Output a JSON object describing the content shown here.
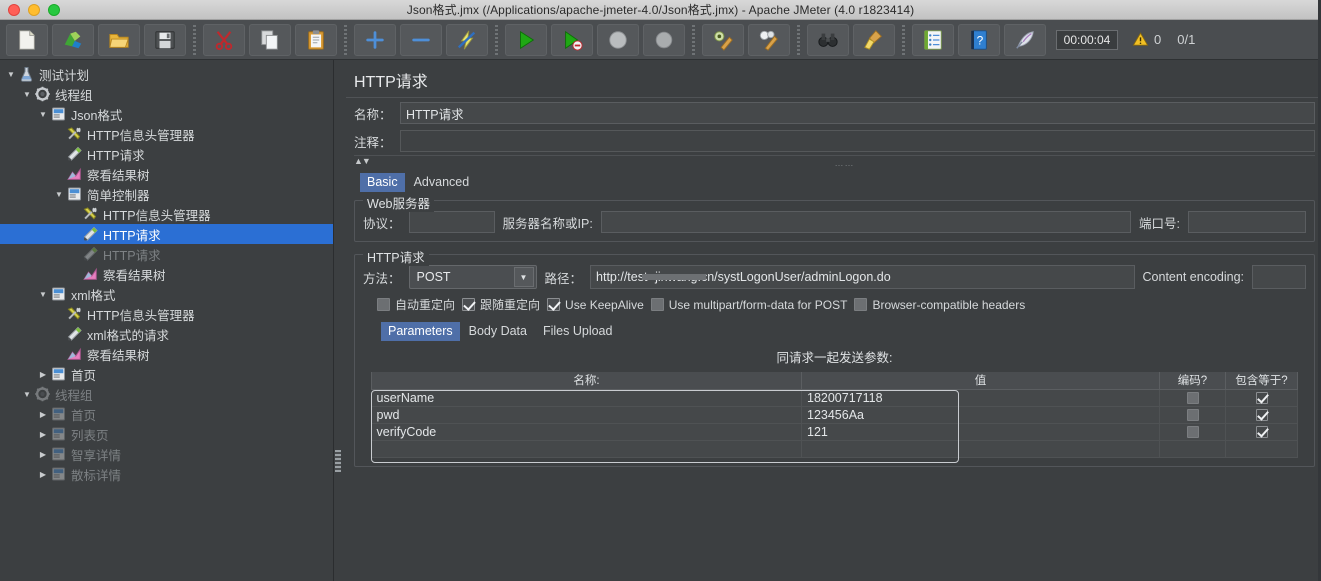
{
  "window": {
    "title": "Json格式.jmx (/Applications/apache-jmeter-4.0/Json格式.jmx) - Apache JMeter (4.0 r1823414)"
  },
  "toolbar": {
    "buttons": [
      {
        "name": "new-test-plan-button",
        "icon": "new-document-icon",
        "label": "New"
      },
      {
        "name": "templates-button",
        "icon": "templates-icon",
        "label": "Templates"
      },
      {
        "name": "open-button",
        "icon": "open-folder-icon",
        "label": "Open"
      },
      {
        "name": "save-button",
        "icon": "save-floppy-icon",
        "label": "Save"
      },
      {
        "name": "cut-button",
        "icon": "scissors-icon",
        "label": "Cut"
      },
      {
        "name": "copy-button",
        "icon": "copy-icon",
        "label": "Copy"
      },
      {
        "name": "paste-button",
        "icon": "clipboard-paste-icon",
        "label": "Paste"
      },
      {
        "name": "expand-all-button",
        "icon": "plus-icon",
        "label": "Expand All"
      },
      {
        "name": "collapse-all-button",
        "icon": "minus-icon",
        "label": "Collapse All"
      },
      {
        "name": "toggle-button",
        "icon": "toggle-bolt-icon",
        "label": "Toggle"
      },
      {
        "name": "start-button",
        "icon": "play-green-icon",
        "label": "Start"
      },
      {
        "name": "start-no-pauses-button",
        "icon": "play-no-pause-icon",
        "label": "Start no pauses"
      },
      {
        "name": "stop-button",
        "icon": "stop-circle-icon",
        "label": "Stop"
      },
      {
        "name": "shutdown-button",
        "icon": "shutdown-circle-icon",
        "label": "Shutdown"
      },
      {
        "name": "clear-button",
        "icon": "clear-gear-brush-icon",
        "label": "Clear"
      },
      {
        "name": "clear-all-button",
        "icon": "clear-all-brush-icon",
        "label": "Clear All"
      },
      {
        "name": "search-button",
        "icon": "binoculars-icon",
        "label": "Search"
      },
      {
        "name": "reset-search-button",
        "icon": "broom-icon",
        "label": "Reset Search"
      },
      {
        "name": "function-helper-button",
        "icon": "notepad-list-icon",
        "label": "Function Helper Dialog"
      },
      {
        "name": "help-button",
        "icon": "help-book-icon",
        "label": "Help"
      },
      {
        "name": "undo-redo-button",
        "icon": "feather-icon",
        "label": "Templates"
      }
    ],
    "elapsed_time": "00:00:04",
    "warning_count": "0",
    "thread_count": "0/1"
  },
  "tree": {
    "nodes": [
      {
        "label": "测试计划",
        "indent": 0,
        "twisty": "down",
        "icon": "test-plan-icon",
        "state": "normal",
        "name": "tree-node-test-plan"
      },
      {
        "label": "线程组",
        "indent": 1,
        "twisty": "down",
        "icon": "thread-group-icon",
        "state": "normal",
        "name": "tree-node-thread-group-1"
      },
      {
        "label": "Json格式",
        "indent": 2,
        "twisty": "down",
        "icon": "controller-icon",
        "state": "normal",
        "name": "tree-node-json-format"
      },
      {
        "label": "HTTP信息头管理器",
        "indent": 3,
        "twisty": "none",
        "icon": "header-manager-icon",
        "state": "normal",
        "name": "tree-node-header-manager-1"
      },
      {
        "label": "HTTP请求",
        "indent": 3,
        "twisty": "none",
        "icon": "http-sampler-icon",
        "state": "normal",
        "name": "tree-node-http-request-1"
      },
      {
        "label": "察看结果树",
        "indent": 3,
        "twisty": "none",
        "icon": "view-results-tree-icon",
        "state": "normal",
        "name": "tree-node-view-results-tree-1"
      },
      {
        "label": "简单控制器",
        "indent": 3,
        "twisty": "down",
        "icon": "controller-icon",
        "state": "normal",
        "name": "tree-node-simple-controller"
      },
      {
        "label": "HTTP信息头管理器",
        "indent": 4,
        "twisty": "none",
        "icon": "header-manager-icon",
        "state": "normal",
        "name": "tree-node-header-manager-2"
      },
      {
        "label": "HTTP请求",
        "indent": 4,
        "twisty": "none",
        "icon": "http-sampler-icon",
        "state": "selected",
        "name": "tree-node-http-request-selected"
      },
      {
        "label": "HTTP请求",
        "indent": 4,
        "twisty": "none",
        "icon": "http-sampler-icon",
        "state": "disabled",
        "name": "tree-node-http-request-disabled"
      },
      {
        "label": "察看结果树",
        "indent": 4,
        "twisty": "none",
        "icon": "view-results-tree-icon",
        "state": "normal",
        "name": "tree-node-view-results-tree-2"
      },
      {
        "label": "xml格式",
        "indent": 2,
        "twisty": "down",
        "icon": "controller-icon",
        "state": "normal",
        "name": "tree-node-xml-format"
      },
      {
        "label": "HTTP信息头管理器",
        "indent": 3,
        "twisty": "none",
        "icon": "header-manager-icon",
        "state": "normal",
        "name": "tree-node-header-manager-3"
      },
      {
        "label": "xml格式的请求",
        "indent": 3,
        "twisty": "none",
        "icon": "http-sampler-icon",
        "state": "normal",
        "name": "tree-node-xml-request"
      },
      {
        "label": "察看结果树",
        "indent": 3,
        "twisty": "none",
        "icon": "view-results-tree-icon",
        "state": "normal",
        "name": "tree-node-view-results-tree-3"
      },
      {
        "label": "首页",
        "indent": 2,
        "twisty": "right",
        "icon": "controller-icon",
        "state": "normal",
        "name": "tree-node-home-page-1"
      },
      {
        "label": "线程组",
        "indent": 1,
        "twisty": "down",
        "icon": "thread-group-icon",
        "state": "disabled",
        "name": "tree-node-thread-group-2"
      },
      {
        "label": "首页",
        "indent": 2,
        "twisty": "right",
        "icon": "controller-icon",
        "state": "disabled",
        "name": "tree-node-home-page-2"
      },
      {
        "label": "列表页",
        "indent": 2,
        "twisty": "right",
        "icon": "controller-icon",
        "state": "disabled",
        "name": "tree-node-list-page"
      },
      {
        "label": "智享详情",
        "indent": 2,
        "twisty": "right",
        "icon": "controller-icon",
        "state": "disabled",
        "name": "tree-node-detail-page-1"
      },
      {
        "label": "散标详情",
        "indent": 2,
        "twisty": "right",
        "icon": "controller-icon",
        "state": "disabled",
        "name": "tree-node-detail-page-2"
      }
    ]
  },
  "main": {
    "heading": "HTTP请求",
    "name_label": "名称：",
    "name_value": "HTTP请求",
    "comment_label": "注释：",
    "comment_value": "",
    "tabs": [
      {
        "label": "Basic",
        "active": true,
        "name": "tab-basic"
      },
      {
        "label": "Advanced",
        "active": false,
        "name": "tab-advanced"
      }
    ],
    "web_server": {
      "title": "Web服务器",
      "protocol_label": "协议：",
      "protocol_value": "",
      "server_label": "服务器名称或IP:",
      "server_value": "",
      "port_label": "端口号:",
      "port_value": ""
    },
    "http_request": {
      "title": "HTTP请求",
      "method_label": "方法：",
      "method_value": "POST",
      "path_label": "路径：",
      "path_value": "http://test-            jinwang.cn/systLogonUser/adminLogon.do",
      "content_encoding_label": "Content encoding:",
      "content_encoding_value": ""
    },
    "options": [
      {
        "label": "自动重定向",
        "checked": false,
        "name": "checkbox-follow-redirects-auto"
      },
      {
        "label": "跟随重定向",
        "checked": true,
        "name": "checkbox-follow-redirects"
      },
      {
        "label": "Use KeepAlive",
        "checked": true,
        "name": "checkbox-use-keepalive"
      },
      {
        "label": "Use multipart/form-data for POST",
        "checked": false,
        "name": "checkbox-multipart"
      },
      {
        "label": "Browser-compatible headers",
        "checked": false,
        "name": "checkbox-browser-compatible-headers"
      }
    ],
    "sub_tabs": [
      {
        "label": "Parameters",
        "active": true,
        "name": "tab-parameters"
      },
      {
        "label": "Body Data",
        "active": false,
        "name": "tab-body-data"
      },
      {
        "label": "Files Upload",
        "active": false,
        "name": "tab-files-upload"
      }
    ],
    "params_caption": "同请求一起发送参数:",
    "params_table": {
      "columns": [
        "名称:",
        "值",
        "编码?",
        "包含等于?"
      ],
      "rows": [
        {
          "name": "userName",
          "value": "18200717118",
          "encode": false,
          "include_equals": true
        },
        {
          "name": "pwd",
          "value": "123456Aa",
          "encode": false,
          "include_equals": true
        },
        {
          "name": "verifyCode",
          "value": "121",
          "encode": false,
          "include_equals": true
        }
      ]
    }
  },
  "colors": {
    "accent": "#2b6fd4",
    "tab_active": "#4f6fa8",
    "panel_bg": "#3c3f41",
    "toolbar_bg": "#4a4d50"
  }
}
